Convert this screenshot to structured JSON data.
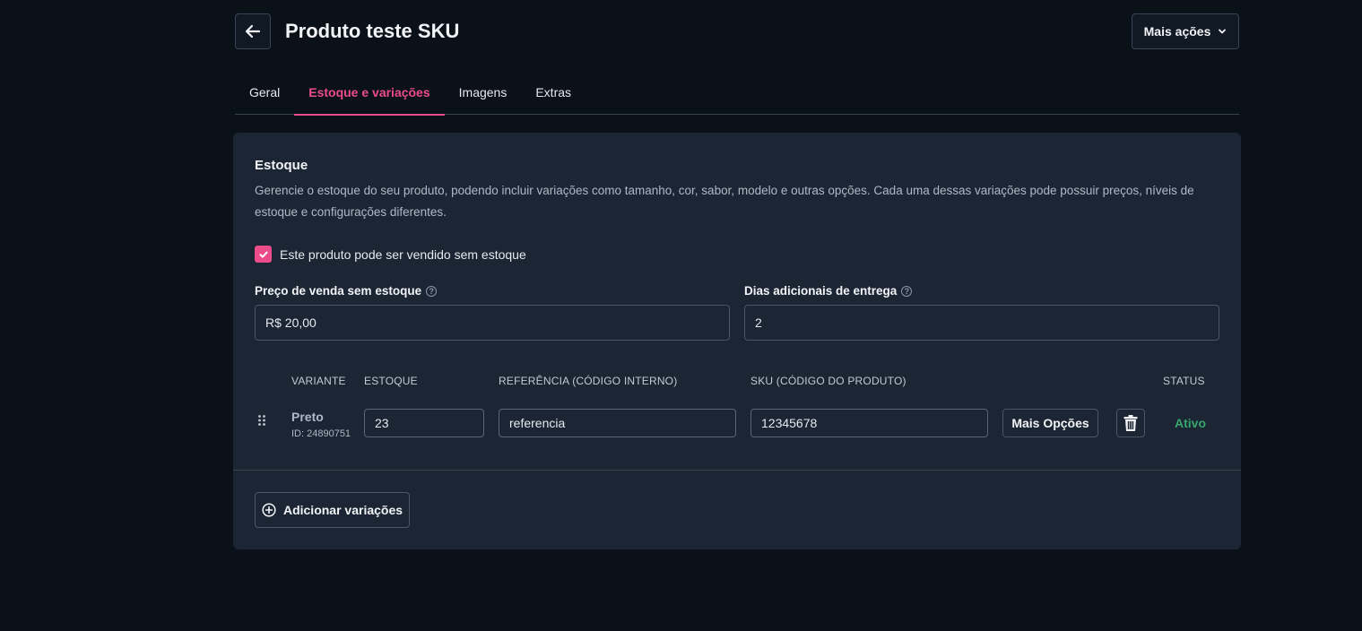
{
  "header": {
    "title": "Produto teste SKU",
    "more_actions_label": "Mais ações",
    "back_icon": "arrow-left-icon",
    "chevron_icon": "chevron-down-icon"
  },
  "tabs": [
    {
      "label": "Geral",
      "active": false
    },
    {
      "label": "Estoque e variações",
      "active": true
    },
    {
      "label": "Imagens",
      "active": false
    },
    {
      "label": "Extras",
      "active": false
    }
  ],
  "stock": {
    "title": "Estoque",
    "description": "Gerencie o estoque do seu produto, podendo incluir variações como tamanho, cor, sabor, modelo e outras opções. Cada uma dessas variações pode possuir preços, níveis de estoque e configurações diferentes.",
    "sell_without_stock": {
      "label": "Este produto pode ser vendido sem estoque",
      "checked": true
    },
    "price_without_stock": {
      "label": "Preço de venda sem estoque",
      "value": "R$ 20,00"
    },
    "extra_delivery_days": {
      "label": "Dias adicionais de entrega",
      "value": "2"
    },
    "help_icon_glyph": "?"
  },
  "variants_table": {
    "columns": {
      "variant": "VARIANTE",
      "stock": "ESTOQUE",
      "reference": "REFERÊNCIA (CÓDIGO INTERNO)",
      "sku": "SKU (CÓDIGO DO PRODUTO)",
      "status": "STATUS"
    },
    "rows": [
      {
        "name": "Preto",
        "id": "ID: 24890751",
        "stock": "23",
        "reference": "referencia",
        "sku": "12345678",
        "more_options_label": "Mais Opções",
        "status": "Ativo"
      }
    ]
  },
  "add_variations_label": "Adicionar variações",
  "colors": {
    "accent": "#ec4c8a",
    "status_active": "#36a66b",
    "background": "#0b1119",
    "card": "#1b2533"
  }
}
